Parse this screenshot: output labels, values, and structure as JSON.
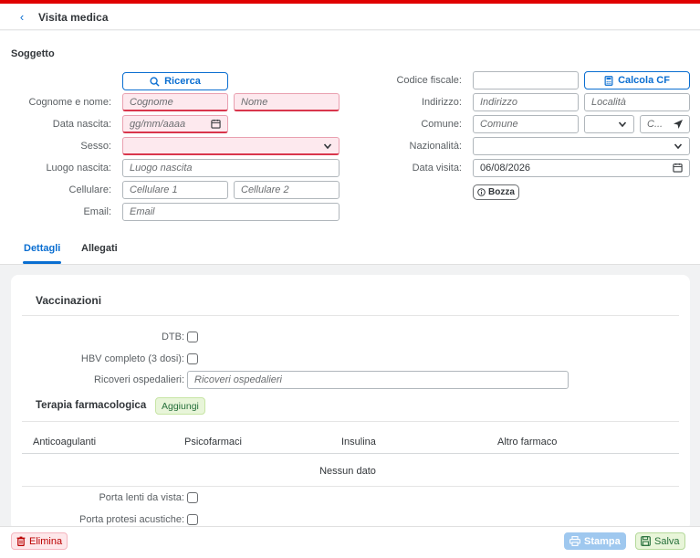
{
  "header": {
    "title": "Visita medica"
  },
  "subject": {
    "section_title": "Soggetto",
    "search_button": "Ricerca",
    "calc_cf_button": "Calcola CF",
    "labels": {
      "cognome_nome": "Cognome e nome:",
      "data_nascita": "Data nascita:",
      "sesso": "Sesso:",
      "luogo_nascita": "Luogo nascita:",
      "cellulare": "Cellulare:",
      "email": "Email:",
      "codice_fiscale": "Codice fiscale:",
      "indirizzo": "Indirizzo:",
      "comune": "Comune:",
      "nazionalita": "Nazionalità:",
      "data_visita": "Data visita:"
    },
    "placeholders": {
      "cognome": "Cognome",
      "nome": "Nome",
      "data_nascita": "gg/mm/aaaa",
      "luogo_nascita": "Luogo nascita",
      "cellulare1": "Cellulare 1",
      "cellulare2": "Cellulare 2",
      "email": "Email",
      "indirizzo": "Indirizzo",
      "localita": "Località",
      "comune": "Comune",
      "cap": "C..."
    },
    "values": {
      "data_visita": "06/08/2026"
    },
    "status_chip": "Bozza"
  },
  "tabs": [
    {
      "label": "Dettagli",
      "active": true
    },
    {
      "label": "Allegati",
      "active": false
    }
  ],
  "details": {
    "vaccinazioni_title": "Vaccinazioni",
    "dtb_label": "DTB:",
    "hbv_label": "HBV completo (3 dosi):",
    "ricoveri_label": "Ricoveri ospedalieri:",
    "ricoveri_placeholder": "Ricoveri ospedalieri",
    "terapia_title": "Terapia farmacologica",
    "add_button": "Aggiungi",
    "table_columns": [
      "Anticoagulanti",
      "Psicofarmaci",
      "Insulina",
      "Altro farmaco"
    ],
    "empty_text": "Nessun dato",
    "lenti_label": "Porta lenti da vista:",
    "protesi_label": "Porta protesi acustiche:"
  },
  "footer": {
    "delete": "Elimina",
    "print": "Stampa",
    "save": "Salva"
  },
  "colors": {
    "accent": "#0a6ed1",
    "required_bg": "#fde9ee",
    "danger": "#bb0000",
    "success": "#256f3a"
  }
}
